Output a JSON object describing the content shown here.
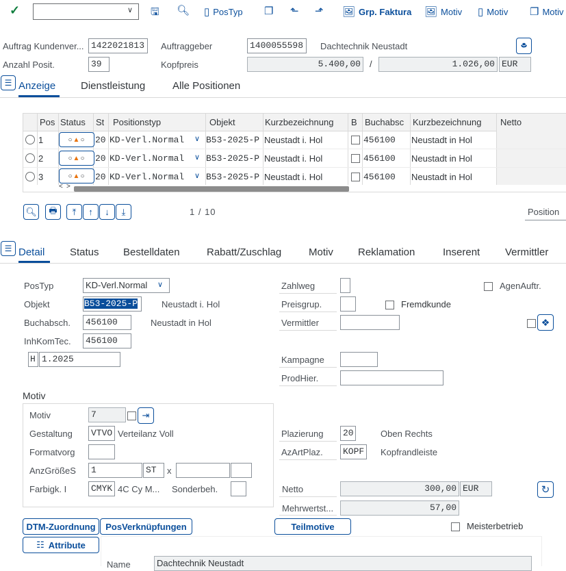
{
  "toolbar": {
    "command_value": "",
    "items": [
      {
        "label": "PosTyp"
      },
      {
        "label": "Grp. Faktura"
      },
      {
        "label": "Motiv"
      },
      {
        "label": "Motiv"
      },
      {
        "label": "Motiv"
      }
    ]
  },
  "header": {
    "auftrag_label": "Auftrag Kundenver...",
    "auftrag_value": "1422021813",
    "anzahl_label": "Anzahl Posit.",
    "anzahl_value": "39",
    "auftraggeber_label": "Auftraggeber",
    "auftraggeber_value": "1400055598",
    "auftraggeber_name": "Dachtechnik Neustadt",
    "kopfpreis_label": "Kopfpreis",
    "kopfpreis_value": "5.400,00",
    "kopfpreis_sep": "/",
    "kopfpreis_value2": "1.026,00",
    "currency": "EUR"
  },
  "top_tabs": [
    {
      "label": "Anzeige",
      "active": true
    },
    {
      "label": "Dienstleistung"
    },
    {
      "label": "Alle Positionen"
    }
  ],
  "grid": {
    "columns": [
      "Pos",
      "Status",
      "St",
      "Positionstyp",
      "Objekt",
      "Kurzbezeichnung",
      "B",
      "Buchabsc",
      "Kurzbezeichnung",
      "Netto"
    ],
    "rows": [
      {
        "pos": "1",
        "st": "20",
        "typ": "KD-Verl.Normal",
        "objekt": "B53-2025-P",
        "kurz": "Neustadt i. Hol",
        "buch": "456100",
        "kurz2": "Neustadt in Hol"
      },
      {
        "pos": "2",
        "st": "20",
        "typ": "KD-Verl.Normal",
        "objekt": "B53-2025-P",
        "kurz": "Neustadt i. Hol",
        "buch": "456100",
        "kurz2": "Neustadt in Hol"
      },
      {
        "pos": "3",
        "st": "20",
        "typ": "KD-Verl.Normal",
        "objekt": "B53-2025-P",
        "kurz": "Neustadt i. Hol",
        "buch": "456100",
        "kurz2": "Neustadt in Hol"
      }
    ],
    "pager": "1 / 10",
    "position_label": "Position"
  },
  "detail_tabs": [
    {
      "label": "Detail",
      "active": true
    },
    {
      "label": "Status"
    },
    {
      "label": "Bestelldaten"
    },
    {
      "label": "Rabatt/Zuschlag"
    },
    {
      "label": "Motiv"
    },
    {
      "label": "Reklamation"
    },
    {
      "label": "Inserent"
    },
    {
      "label": "Vermittler"
    }
  ],
  "detail": {
    "postyp_label": "PosTyp",
    "postyp_value": "KD-Verl.Normal",
    "objekt_label": "Objekt",
    "objekt_value": "B53-2025-P",
    "objekt_desc": "Neustadt i. Hol",
    "buch_label": "Buchabsch.",
    "buch_value": "456100",
    "buch_desc": "Neustadt in Hol",
    "inhkom_label": "InhKomTec.",
    "inhkom_value": "456100",
    "period_prefix": "H",
    "period_value": "1.2025",
    "zahlweg_label": "Zahlweg",
    "preisgrup_label": "Preisgrup.",
    "vermittler_label": "Vermittler",
    "kampagne_label": "Kampagne",
    "prodhier_label": "ProdHier.",
    "agenauftr_label": "AgenAuftr.",
    "fremdkunde_label": "Fremdkunde"
  },
  "motiv": {
    "section_title": "Motiv",
    "motiv_label": "Motiv",
    "motiv_value": "7",
    "gestaltung_label": "Gestaltung",
    "gestaltung_value": "VTVO",
    "gestaltung_desc": "Verteilanz Voll",
    "formatvorg_label": "Formatvorg",
    "anzgroesse_label": "AnzGrößeS",
    "anzgroesse_value": "1",
    "anzgroesse_unit": "ST",
    "x_label": "x",
    "farbigk_label": "Farbigk. I",
    "farbigk_value": "CMYK",
    "farbigk_desc": "4C Cy M...",
    "sonderbeh_label": "Sonderbeh."
  },
  "placement": {
    "plazierung_label": "Plazierung",
    "plazierung_value": "20",
    "plazierung_desc": "Oben Rechts",
    "azartplaz_label": "AzArtPlaz.",
    "azartplaz_value": "KOPF",
    "azartplaz_desc": "Kopfrandleiste",
    "netto_label": "Netto",
    "netto_value": "300,00",
    "netto_currency": "EUR",
    "mwst_label": "Mehrwertst...",
    "mwst_value": "57,00"
  },
  "buttons": {
    "dtm": "DTM-Zuordnung",
    "posverk": "PosVerknüpfungen",
    "teilmotive": "Teilmotive",
    "meisterbetrieb": "Meisterbetrieb",
    "attribute": "Attribute"
  },
  "bottom": {
    "name_label": "Name",
    "name_value": "Dachtechnik Neustadt"
  },
  "colors": {
    "accent": "#0a4e9b",
    "ok_green": "#107e3e",
    "status_orange": "#e9730c"
  }
}
